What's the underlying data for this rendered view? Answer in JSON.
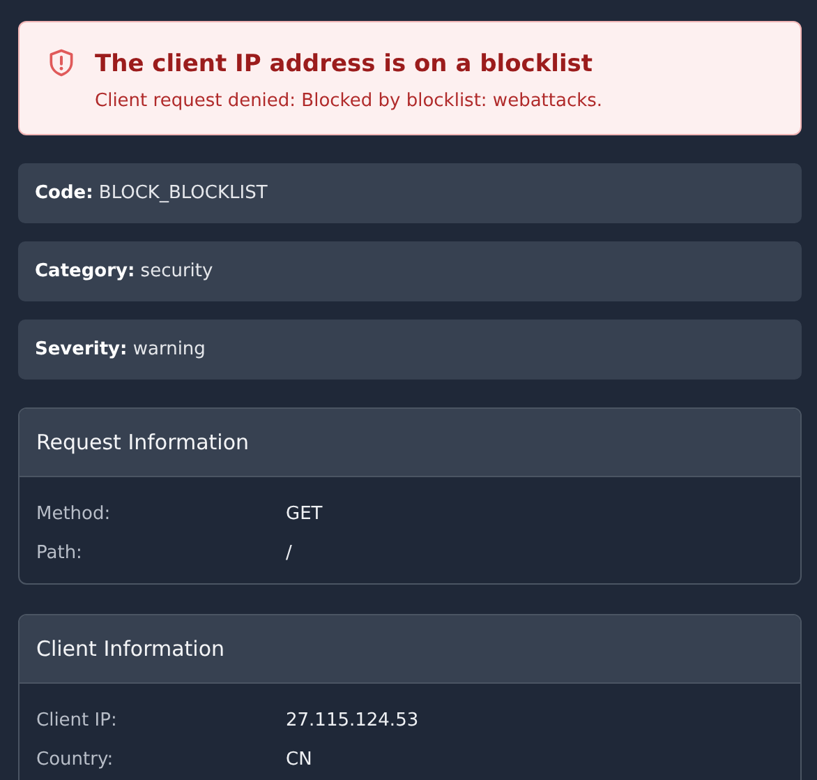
{
  "alert": {
    "title": "The client IP address is on a blocklist",
    "message": "Client request denied: Blocked by blocklist: webattacks."
  },
  "fields": [
    {
      "text": "**Code:** BLOCK_BLOCKLIST"
    },
    {
      "text": "**Category:** security"
    },
    {
      "text": "**Severity:** warning"
    }
  ],
  "sections": [
    {
      "title": "Request Information",
      "rows": [
        {
          "label": "Method:",
          "value": "GET"
        },
        {
          "label": "Path:",
          "value": "/"
        }
      ]
    },
    {
      "title": "Client Information",
      "rows": [
        {
          "label": "Client IP:",
          "value": "27.115.124.53"
        },
        {
          "label": "Country:",
          "value": "CN"
        }
      ]
    }
  ]
}
